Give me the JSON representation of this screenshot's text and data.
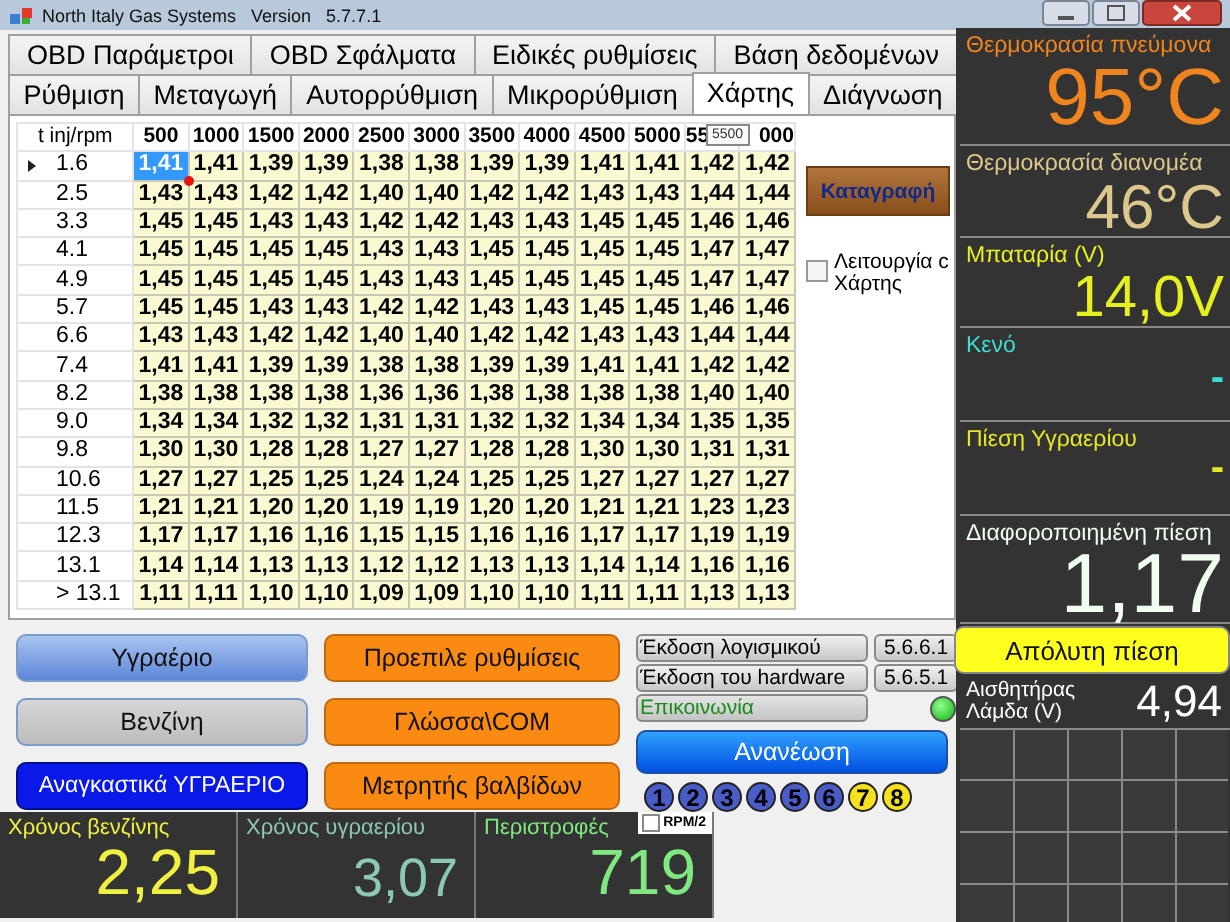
{
  "window": {
    "title": "North Italy Gas Systems   Version   5.7.7.1"
  },
  "tabs_top": [
    {
      "label": "OBD Παράμετροι",
      "selected": false
    },
    {
      "label": "OBD Σφάλματα",
      "selected": false
    },
    {
      "label": "Ειδικές ρυθμίσεις",
      "selected": false
    },
    {
      "label": "Βάση δεδομένων",
      "selected": false
    }
  ],
  "tabs_bottom": [
    {
      "label": "Ρύθμιση",
      "selected": false
    },
    {
      "label": "Μεταγωγή",
      "selected": false
    },
    {
      "label": "Αυτορρύθμιση",
      "selected": false
    },
    {
      "label": "Μικρορύθμιση",
      "selected": false
    },
    {
      "label": "Χάρτης",
      "selected": true
    },
    {
      "label": "Διάγνωση",
      "selected": false
    }
  ],
  "map": {
    "corner": "t inj/rpm",
    "columns": [
      "500",
      "1000",
      "1500",
      "2000",
      "2500",
      "3000",
      "3500",
      "4000",
      "4500",
      "5000",
      "55",
      "000"
    ],
    "tooltip": "5500",
    "rows": [
      {
        "label": "1.6",
        "selected": true,
        "marker": false,
        "cells": [
          "1,41",
          "1,41",
          "1,39",
          "1,39",
          "1,38",
          "1,38",
          "1,39",
          "1,39",
          "1,41",
          "1,41",
          "1,42",
          "1,42"
        ]
      },
      {
        "label": "2.5",
        "selected": false,
        "marker": true,
        "cells": [
          "1,43",
          "1,43",
          "1,42",
          "1,42",
          "1,40",
          "1,40",
          "1,42",
          "1,42",
          "1,43",
          "1,43",
          "1,44",
          "1,44"
        ]
      },
      {
        "label": "3.3",
        "selected": false,
        "marker": false,
        "cells": [
          "1,45",
          "1,45",
          "1,43",
          "1,43",
          "1,42",
          "1,42",
          "1,43",
          "1,43",
          "1,45",
          "1,45",
          "1,46",
          "1,46"
        ]
      },
      {
        "label": "4.1",
        "selected": false,
        "marker": false,
        "cells": [
          "1,45",
          "1,45",
          "1,45",
          "1,45",
          "1,43",
          "1,43",
          "1,45",
          "1,45",
          "1,45",
          "1,45",
          "1,47",
          "1,47"
        ]
      },
      {
        "label": "4.9",
        "selected": false,
        "marker": false,
        "cells": [
          "1,45",
          "1,45",
          "1,45",
          "1,45",
          "1,43",
          "1,43",
          "1,45",
          "1,45",
          "1,45",
          "1,45",
          "1,47",
          "1,47"
        ]
      },
      {
        "label": "5.7",
        "selected": false,
        "marker": false,
        "cells": [
          "1,45",
          "1,45",
          "1,43",
          "1,43",
          "1,42",
          "1,42",
          "1,43",
          "1,43",
          "1,45",
          "1,45",
          "1,46",
          "1,46"
        ]
      },
      {
        "label": "6.6",
        "selected": false,
        "marker": false,
        "cells": [
          "1,43",
          "1,43",
          "1,42",
          "1,42",
          "1,40",
          "1,40",
          "1,42",
          "1,42",
          "1,43",
          "1,43",
          "1,44",
          "1,44"
        ]
      },
      {
        "label": "7.4",
        "selected": false,
        "marker": false,
        "cells": [
          "1,41",
          "1,41",
          "1,39",
          "1,39",
          "1,38",
          "1,38",
          "1,39",
          "1,39",
          "1,41",
          "1,41",
          "1,42",
          "1,42"
        ]
      },
      {
        "label": "8.2",
        "selected": false,
        "marker": false,
        "cells": [
          "1,38",
          "1,38",
          "1,38",
          "1,38",
          "1,36",
          "1,36",
          "1,38",
          "1,38",
          "1,38",
          "1,38",
          "1,40",
          "1,40"
        ]
      },
      {
        "label": "9.0",
        "selected": false,
        "marker": false,
        "cells": [
          "1,34",
          "1,34",
          "1,32",
          "1,32",
          "1,31",
          "1,31",
          "1,32",
          "1,32",
          "1,34",
          "1,34",
          "1,35",
          "1,35"
        ]
      },
      {
        "label": "9.8",
        "selected": false,
        "marker": false,
        "cells": [
          "1,30",
          "1,30",
          "1,28",
          "1,28",
          "1,27",
          "1,27",
          "1,28",
          "1,28",
          "1,30",
          "1,30",
          "1,31",
          "1,31"
        ]
      },
      {
        "label": "10.6",
        "selected": false,
        "marker": false,
        "cells": [
          "1,27",
          "1,27",
          "1,25",
          "1,25",
          "1,24",
          "1,24",
          "1,25",
          "1,25",
          "1,27",
          "1,27",
          "1,27",
          "1,27"
        ]
      },
      {
        "label": "11.5",
        "selected": false,
        "marker": false,
        "cells": [
          "1,21",
          "1,21",
          "1,20",
          "1,20",
          "1,19",
          "1,19",
          "1,20",
          "1,20",
          "1,21",
          "1,21",
          "1,23",
          "1,23"
        ]
      },
      {
        "label": "12.3",
        "selected": false,
        "marker": false,
        "cells": [
          "1,17",
          "1,17",
          "1,16",
          "1,16",
          "1,15",
          "1,15",
          "1,16",
          "1,16",
          "1,17",
          "1,17",
          "1,19",
          "1,19"
        ]
      },
      {
        "label": "13.1",
        "selected": false,
        "marker": false,
        "cells": [
          "1,14",
          "1,14",
          "1,13",
          "1,13",
          "1,12",
          "1,12",
          "1,13",
          "1,13",
          "1,14",
          "1,14",
          "1,16",
          "1,16"
        ]
      },
      {
        "label": "> 13.1",
        "selected": false,
        "marker": false,
        "cells": [
          "1,11",
          "1,11",
          "1,10",
          "1,10",
          "1,09",
          "1,09",
          "1,10",
          "1,10",
          "1,11",
          "1,11",
          "1,13",
          "1,13"
        ]
      }
    ]
  },
  "record_button": "Καταγραφή",
  "map_mode": {
    "label": "Λειτουργία c Χάρτης",
    "checked": false
  },
  "fuel_buttons": [
    {
      "label": "Υγραέριο",
      "kind": "toggle",
      "selected": true
    },
    {
      "label": "Βενζίνη",
      "kind": "toggle",
      "selected": false
    },
    {
      "label": "Αναγκαστικά ΥΓΡΑΕΡΙΟ",
      "kind": "force",
      "selected": false
    }
  ],
  "settings_buttons": [
    "Προεπιλε ρυθμίσεις",
    "Γλώσσα\\COM",
    "Μετρητής βαλβίδων"
  ],
  "versions": [
    {
      "label": "Έκδοση λογισμικού",
      "value": "5.6.6.1"
    },
    {
      "label": "Έκδοση του hardware",
      "value": "5.6.5.1"
    }
  ],
  "communication": {
    "label": "Επικοινωνία",
    "connected": true
  },
  "refresh_button": "Ανανέωση",
  "channels": [
    {
      "label": "1",
      "color": "#4a5cc8"
    },
    {
      "label": "2",
      "color": "#4a5cc8"
    },
    {
      "label": "3",
      "color": "#4a5cc8"
    },
    {
      "label": "4",
      "color": "#4a5cc8"
    },
    {
      "label": "5",
      "color": "#4a5cc8"
    },
    {
      "label": "6",
      "color": "#4a5cc8"
    },
    {
      "label": "7",
      "color": "#f5e11e"
    },
    {
      "label": "8",
      "color": "#f5e11e"
    }
  ],
  "readouts": [
    {
      "label": "Χρόνος βενζίνης",
      "value": "2,25",
      "color": "#f0f040"
    },
    {
      "label": "Χρόνος υγραερίου",
      "value": "3,07",
      "color": "#8cc8b4"
    },
    {
      "label": "Περιστροφές",
      "value": "719",
      "color": "#80e880",
      "option": {
        "label": "RPM/2",
        "checked": false
      }
    }
  ],
  "sensors": [
    {
      "label": "Θερμοκρασία πνεύμονα",
      "value": "95°C",
      "color": "#f0841e"
    },
    {
      "label": "Θερμοκρασία διανομέα",
      "value": "46°C",
      "color": "#dcc88c"
    },
    {
      "label": "Μπαταρία (V)",
      "value": "14,0V",
      "color": "#e6f01e"
    },
    {
      "label": "Κενό",
      "value": "-",
      "color": "#3cdcd0"
    },
    {
      "label": "Πίεση Υγραερίου",
      "value": "-",
      "color": "#e6e628"
    },
    {
      "label": "Διαφοροποιημένη πίεση",
      "value": "1,17",
      "color": "#f0fff0"
    }
  ],
  "absolute_pressure_button": "Απόλυτη πίεση",
  "lambda": {
    "label": "Αισθητήρας Λάμδα (V)",
    "value": "4,94"
  }
}
